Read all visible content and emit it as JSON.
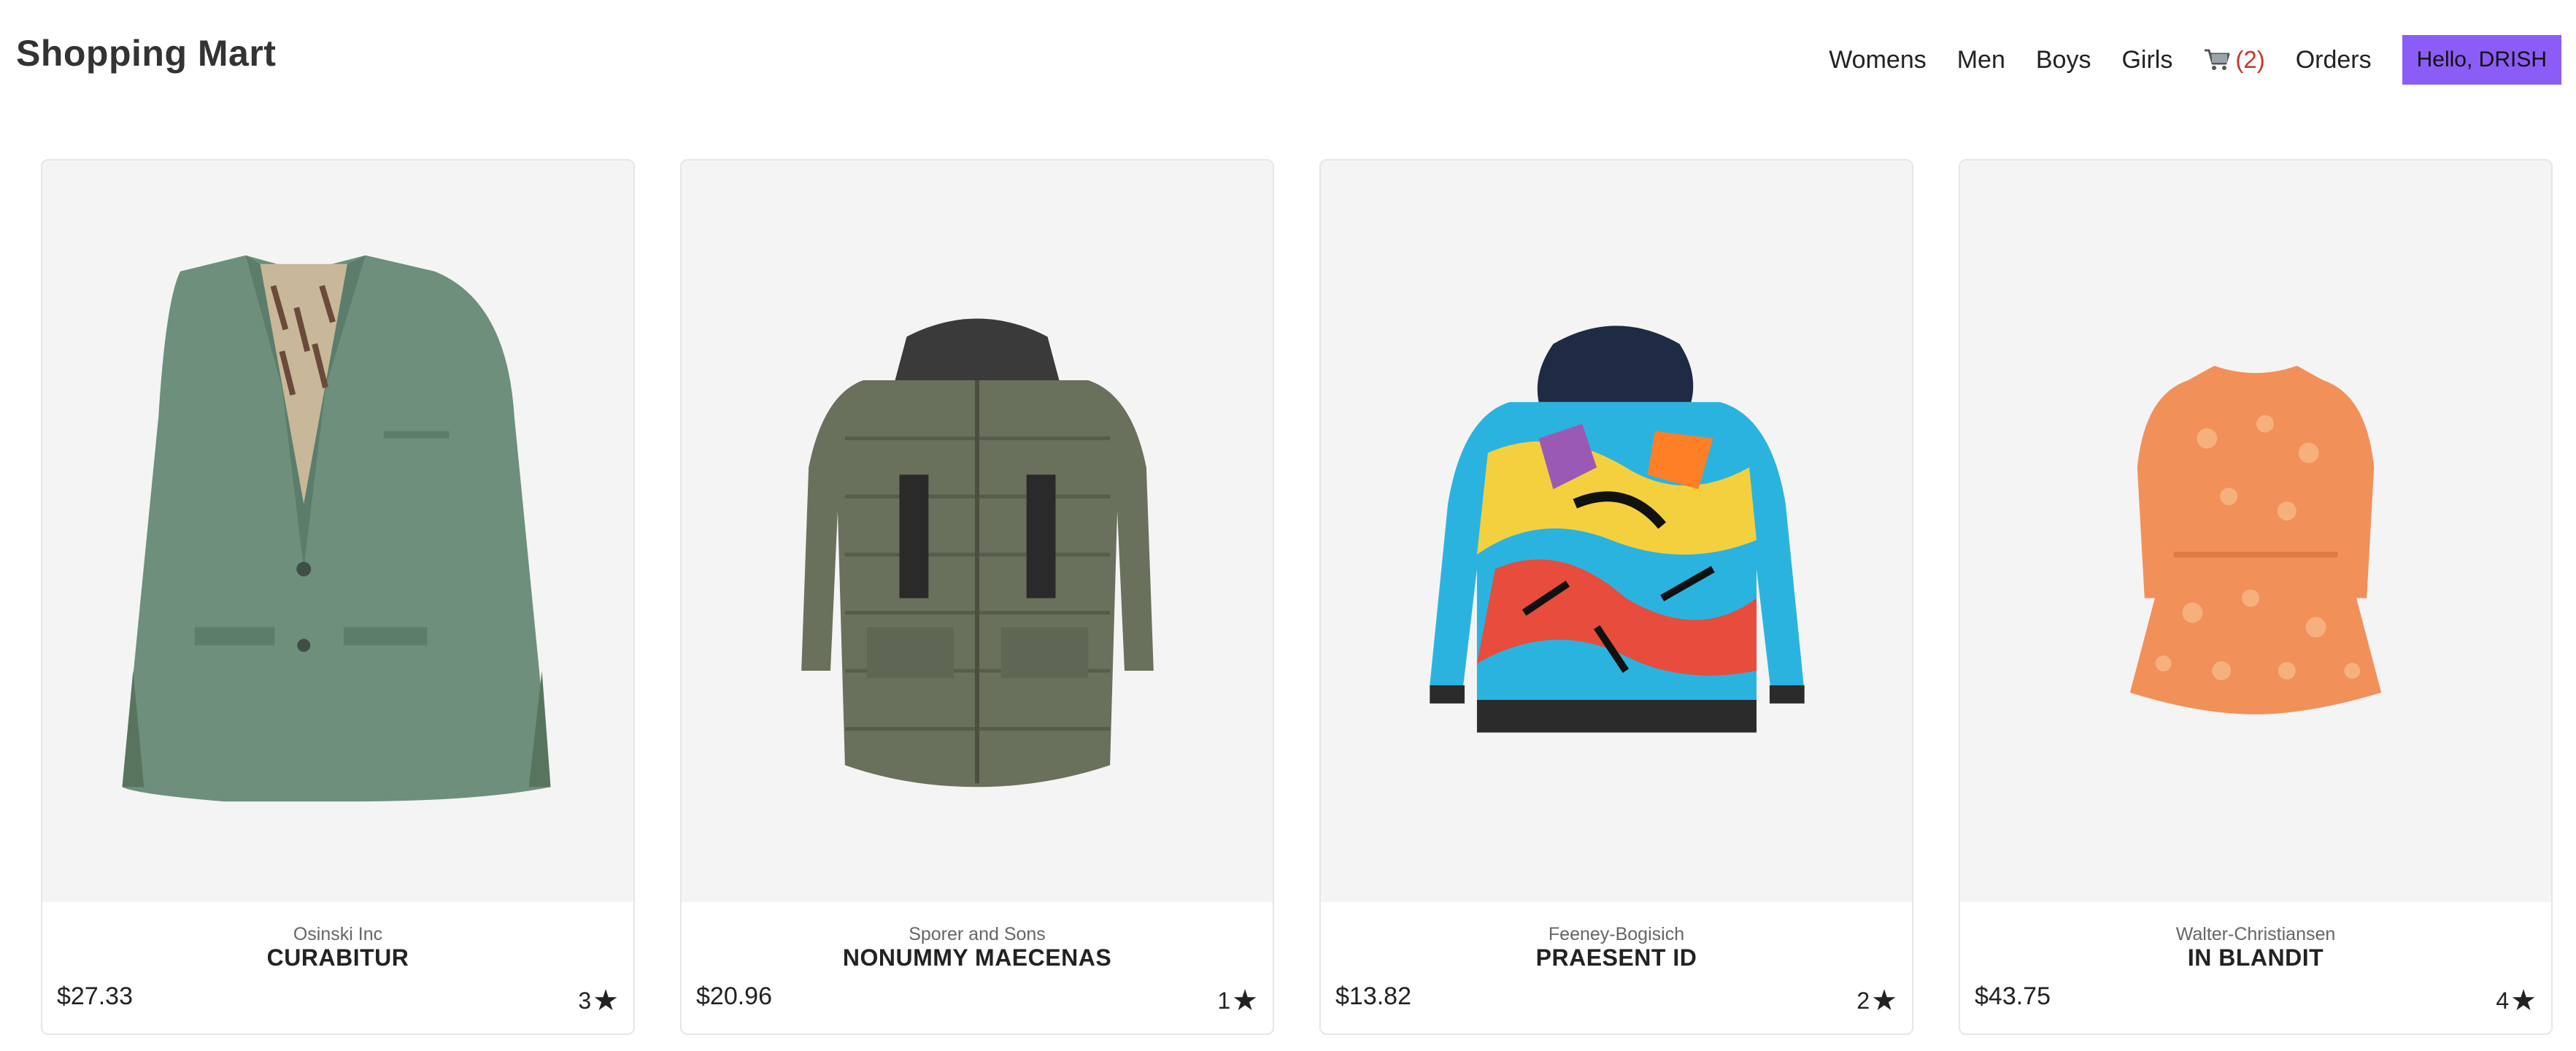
{
  "header": {
    "brand": "Shopping Mart",
    "nav": [
      "Womens",
      "Men",
      "Boys",
      "Girls"
    ],
    "cart_count": "(2)",
    "orders": "Orders",
    "greeting": "Hello, DRISH"
  },
  "colors": {
    "accent": "#8b5cf6",
    "cart_count": "#c0392b",
    "image_bg": "#f4f4f4"
  },
  "products": [
    {
      "brand": "Osinski Inc",
      "name": "CURABITUR",
      "price": "$27.33",
      "rating": "3",
      "image": "green-blazer-image"
    },
    {
      "brand": "Sporer and Sons",
      "name": "NONUMMY MAECENAS",
      "price": "$20.96",
      "rating": "1",
      "image": "olive-puffer-jacket-image"
    },
    {
      "brand": "Feeney-Bogisich",
      "name": "PRAESENT ID",
      "price": "$13.82",
      "rating": "2",
      "image": "graffiti-hoodie-image"
    },
    {
      "brand": "Walter-Christiansen",
      "name": "IN BLANDIT",
      "price": "$43.75",
      "rating": "4",
      "image": "orange-lace-dress-image"
    }
  ]
}
